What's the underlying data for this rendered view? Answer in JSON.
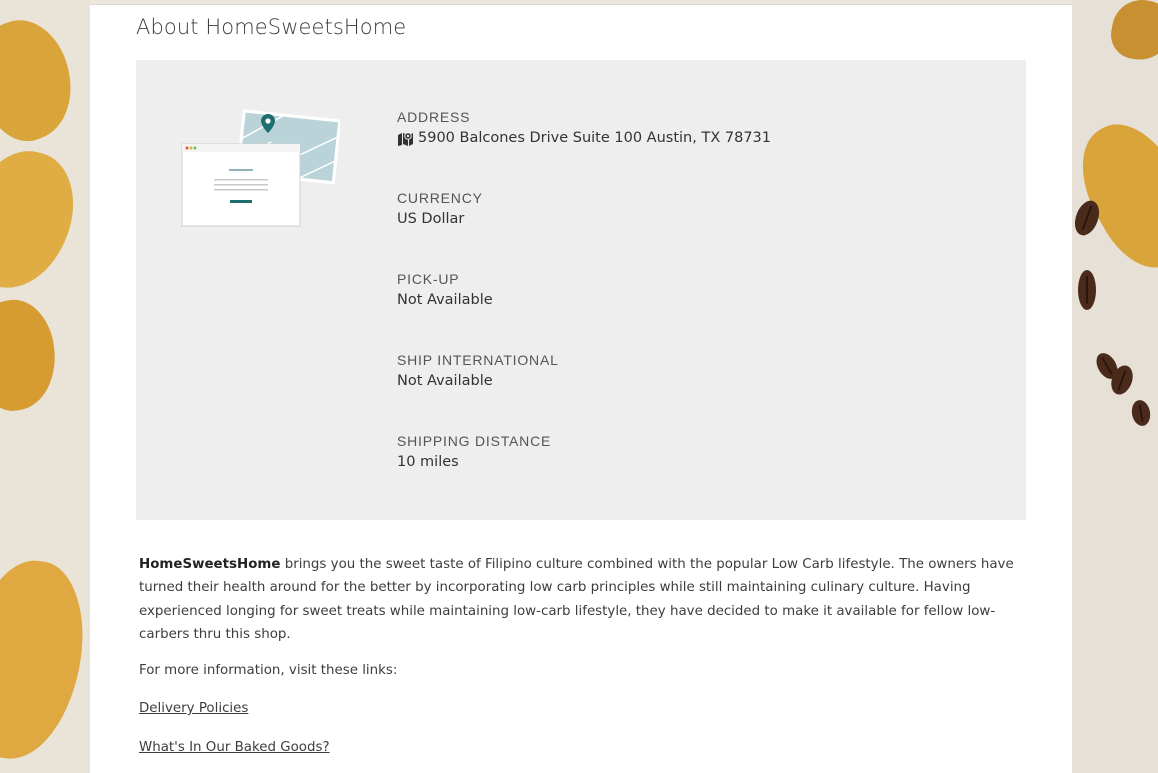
{
  "page": {
    "title": "About HomeSweetsHome"
  },
  "details": [
    {
      "label": "ADDRESS",
      "value": "5900 Balcones Drive Suite 100 Austin, TX 78731",
      "icon": "map-icon"
    },
    {
      "label": "CURRENCY",
      "value": "US Dollar"
    },
    {
      "label": "PICK-UP",
      "value": "Not Available"
    },
    {
      "label": "SHIP INTERNATIONAL",
      "value": "Not Available"
    },
    {
      "label": "SHIPPING DISTANCE",
      "value": "10 miles"
    }
  ],
  "description": {
    "shop_name": "HomeSweetsHome",
    "text": " brings you the sweet taste of Filipino culture combined with the popular Low Carb lifestyle. The owners have turned their health around for the better by incorporating low carb principles while still maintaining culinary culture. Having experienced longing for sweet treats while maintaining low-carb lifestyle, they have decided to make it available for fellow low-carbers thru this shop."
  },
  "more_info": "For more information, visit these links:",
  "links": [
    {
      "label": "Delivery Policies"
    },
    {
      "label": "What's In Our Baked Goods?"
    }
  ],
  "colors": {
    "info_box_bg": "#eeeeee",
    "accent_teal": "#1f6e6e",
    "map_bg": "#b9d3d8"
  }
}
